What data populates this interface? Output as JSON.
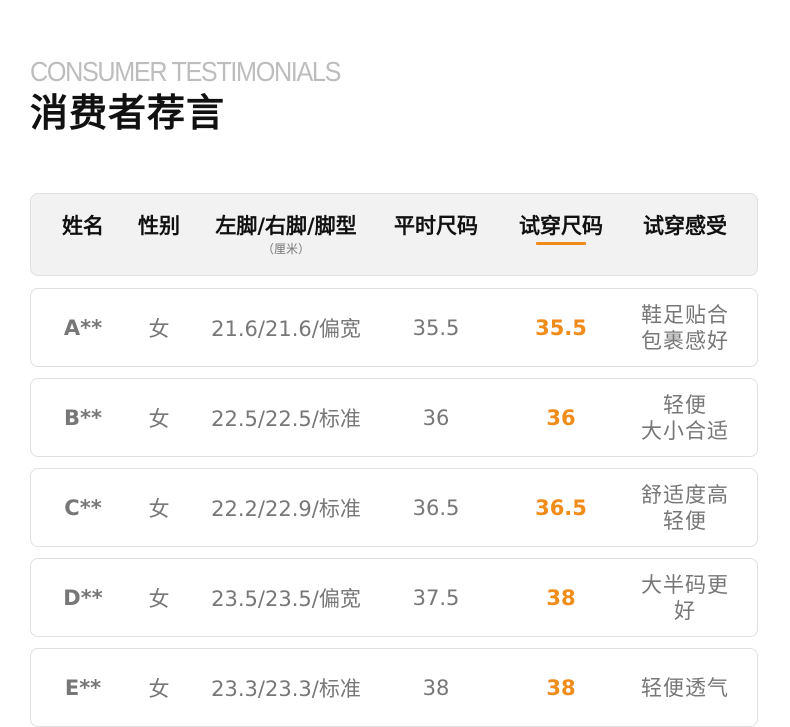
{
  "header": {
    "subtitle_en": "CONSUMER TESTIMONIALS",
    "title_cn": "消费者荐言"
  },
  "table": {
    "columns": [
      {
        "label": "姓名"
      },
      {
        "label": "性别"
      },
      {
        "label": "左脚/右脚/脚型",
        "sub": "（厘米）"
      },
      {
        "label": "平时尺码"
      },
      {
        "label": "试穿尺码"
      },
      {
        "label": "试穿感受"
      }
    ],
    "rows": [
      {
        "name": "A**",
        "gender": "女",
        "feet": "21.6/21.6/偏宽",
        "usual": "35.5",
        "tried": "35.5",
        "feel_1": "鞋足贴合",
        "feel_2": "包裹感好"
      },
      {
        "name": "B**",
        "gender": "女",
        "feet": "22.5/22.5/标准",
        "usual": "36",
        "tried": "36",
        "feel_1": "轻便",
        "feel_2": "大小合适"
      },
      {
        "name": "C**",
        "gender": "女",
        "feet": "22.2/22.9/标准",
        "usual": "36.5",
        "tried": "36.5",
        "feel_1": "舒适度高",
        "feel_2": "轻便"
      },
      {
        "name": "D**",
        "gender": "女",
        "feet": "23.5/23.5/偏宽",
        "usual": "37.5",
        "tried": "38",
        "feel_1": "大半码更",
        "feel_2": "好"
      },
      {
        "name": "E**",
        "gender": "女",
        "feet": "23.3/23.3/标准",
        "usual": "38",
        "tried": "38",
        "feel_1": "轻便透气",
        "feel_2": ""
      }
    ]
  },
  "colors": {
    "accent": "#f08c19",
    "muted_text": "#777777",
    "title": "#111111",
    "subtitle": "#bdbdbd",
    "header_bg": "#f2f2f2",
    "border": "#e0e0e0"
  }
}
